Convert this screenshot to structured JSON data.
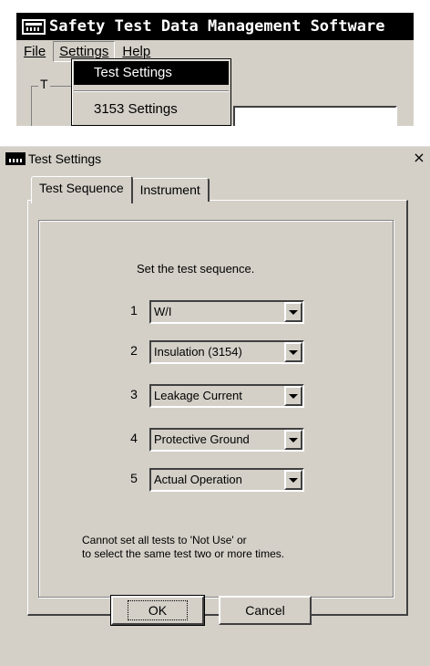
{
  "app": {
    "title": "Safety Test Data Management Software",
    "menu": {
      "file": "File",
      "settings": "Settings",
      "help": "Help"
    },
    "dropdown": {
      "test_settings": "Test Settings",
      "settings_3153": "3153 Settings"
    },
    "group_label_fragment": "T"
  },
  "dialog": {
    "title": "Test Settings",
    "close_glyph": "×",
    "tabs": [
      {
        "label": "Test Sequence",
        "active": true
      },
      {
        "label": "Instrument",
        "active": false
      }
    ],
    "instruction": "Set the test sequence.",
    "sequence": [
      {
        "num": "1",
        "value": "W/I"
      },
      {
        "num": "2",
        "value": "Insulation (3154)"
      },
      {
        "num": "3",
        "value": "Leakage Current"
      },
      {
        "num": "4",
        "value": "Protective Ground"
      },
      {
        "num": "5",
        "value": "Actual Operation"
      }
    ],
    "note_line1": "Cannot set all tests to 'Not Use' or",
    "note_line2": "to select the same test two or more times.",
    "ok_label": "OK",
    "cancel_label": "Cancel"
  },
  "colors": {
    "face": "#d4d0c8",
    "titlebar_active": "#000000",
    "highlight": "#000000"
  }
}
